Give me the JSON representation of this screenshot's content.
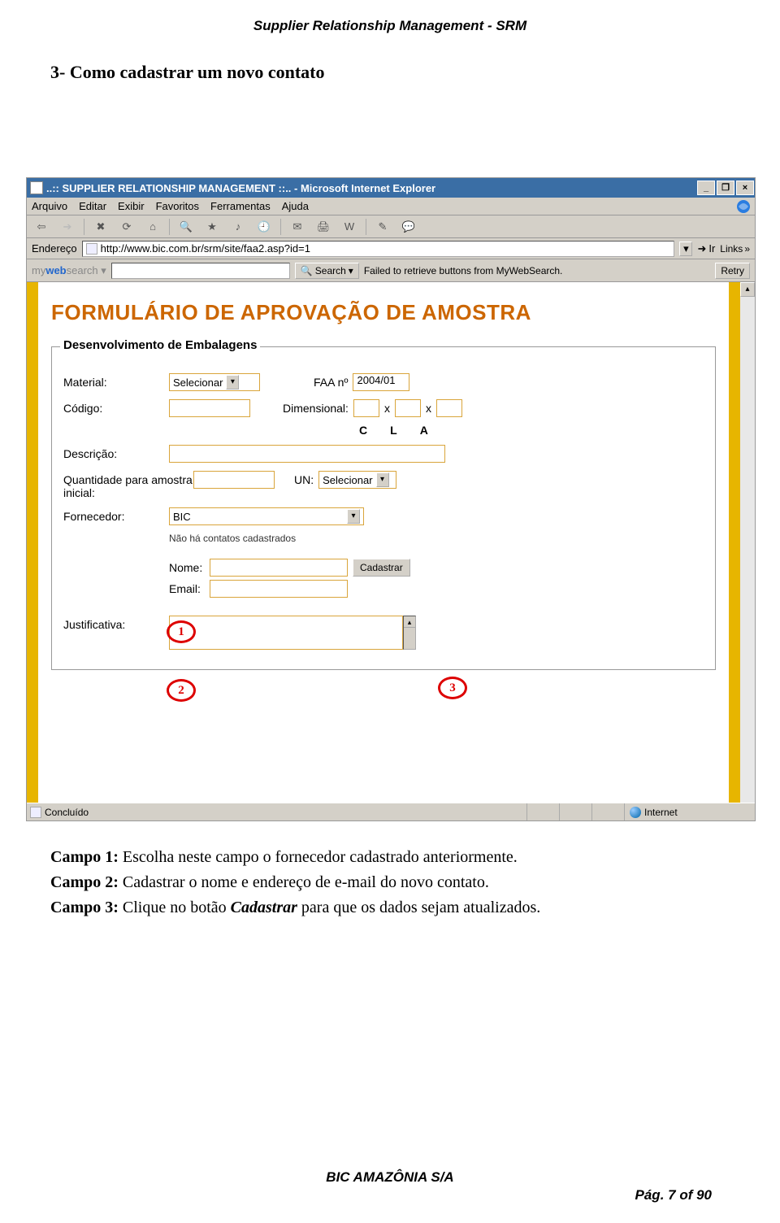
{
  "header": {
    "doc_title": "Supplier Relationship Management - SRM"
  },
  "section": {
    "title": "3-  Como cadastrar um novo contato"
  },
  "browser": {
    "title": "..:: SUPPLIER RELATIONSHIP MANAGEMENT ::.. - Microsoft Internet Explorer",
    "menus": {
      "arquivo": "Arquivo",
      "editar": "Editar",
      "exibir": "Exibir",
      "favoritos": "Favoritos",
      "ferramentas": "Ferramentas",
      "ajuda": "Ajuda"
    },
    "address": {
      "label": "Endereço",
      "url": "http://www.bic.com.br/srm/site/faa2.asp?id=1",
      "ir": "Ir",
      "links": "Links"
    },
    "searchbar": {
      "brand_pre": "my",
      "brand_bold": "web",
      "brand_post": "search",
      "search_btn": "Search",
      "fail_text": "Failed to retrieve buttons from MyWebSearch.",
      "retry": "Retry"
    }
  },
  "form": {
    "title": "FORMULÁRIO DE APROVAÇÃO DE AMOSTRA",
    "legend": "Desenvolvimento de Embalagens",
    "labels": {
      "material": "Material:",
      "faa": "FAA nº",
      "codigo": "Código:",
      "dimensional": "Dimensional:",
      "descricao": "Descrição:",
      "quantidade": "Quantidade para amostra inicial:",
      "un": "UN:",
      "fornecedor": "Fornecedor:",
      "no_contatos": "Não há contatos cadastrados",
      "nome": "Nome:",
      "email": "Email:",
      "justificativa": "Justificativa:"
    },
    "values": {
      "material_sel": "Selecionar",
      "faa_val": "2004/01",
      "un_sel": "Selecionar",
      "fornecedor_sel": "BIC",
      "cla": {
        "c": "C",
        "l": "L",
        "a": "A"
      },
      "cadastrar_btn": "Cadastrar",
      "x": "x"
    }
  },
  "statusbar": {
    "left": "Concluído",
    "right": "Internet"
  },
  "annotations": {
    "a1": "1",
    "a2": "2",
    "a3": "3"
  },
  "body": {
    "p1_lbl": "Campo 1:",
    "p1_txt": " Escolha neste campo o fornecedor cadastrado anteriormente.",
    "p2_lbl": "Campo 2:",
    "p2_txt": " Cadastrar o nome e endereço de e-mail do novo contato.",
    "p3_lbl": "Campo 3:",
    "p3_txt_a": " Clique no botão ",
    "p3_em": "Cadastrar",
    "p3_txt_b": " para que os dados sejam atualizados."
  },
  "footer": {
    "company": "BIC  AMAZÔNIA  S/A",
    "page": "Pág.  7 of 90"
  }
}
